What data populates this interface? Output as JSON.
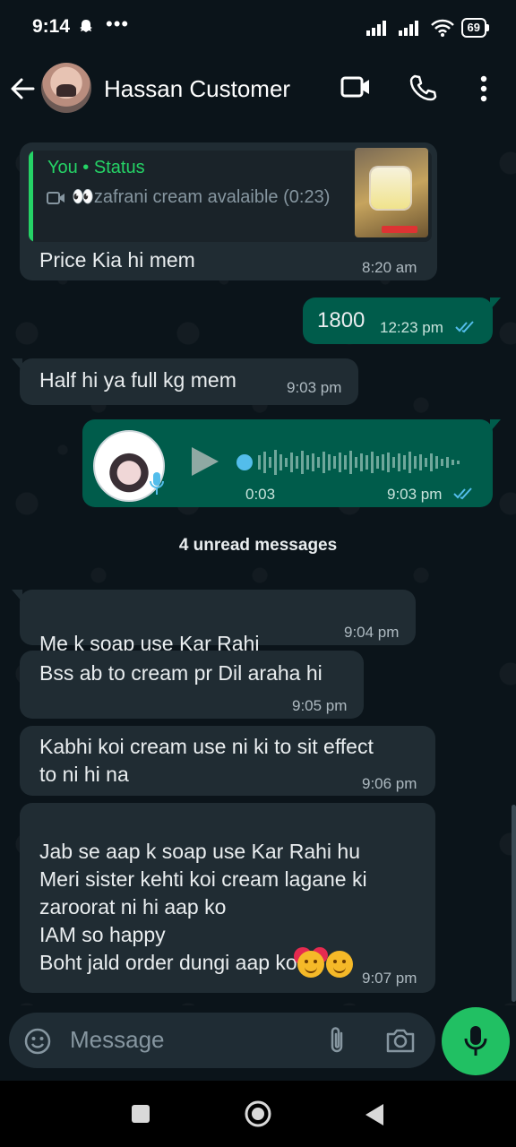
{
  "status_bar": {
    "time": "9:14",
    "battery": "69"
  },
  "header": {
    "contact_name": "Hassan Customer"
  },
  "messages": {
    "m1": {
      "quote_title": "You • Status",
      "quote_text": "👀zafrani cream avalaible (0:23)",
      "text": "Price Kia hi mem",
      "time": "8:20 am"
    },
    "m2": {
      "text": "1800",
      "time": "12:23 pm"
    },
    "m3": {
      "text": "Half hi ya full kg  mem",
      "time": "9:03 pm"
    },
    "m4": {
      "duration": "0:03",
      "time": "9:03 pm"
    },
    "unread_label": "4 unread messages",
    "m5": {
      "text": "Me k soap use Kar Rahi ",
      "time": "9:04 pm"
    },
    "m6": {
      "text": "Bss ab to cream pr Dil araha hi",
      "time": "9:05 pm"
    },
    "m7": {
      "text": "Kabhi koi cream use ni ki to sit effect\nto ni hi na",
      "time": "9:06 pm"
    },
    "m8": {
      "text": "Jab se aap k soap use Kar Rahi hu\nMeri sister kehti koi cream lagane ki\nzaroorat  ni hi aap ko\nIAM so happy\nBoht jald order dungi aap ko",
      "time": "9:07 pm"
    }
  },
  "input": {
    "placeholder": "Message"
  },
  "colors": {
    "accent": "#25d366",
    "incoming": "#202c33",
    "outgoing": "#005c4b",
    "background": "#0b141a"
  }
}
